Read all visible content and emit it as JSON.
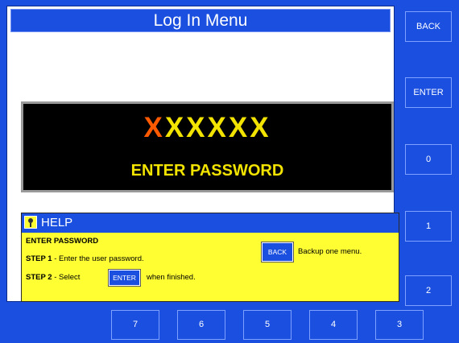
{
  "title": "Log In Menu",
  "password_display": {
    "first_char": "X",
    "rest": "XXXXX",
    "prompt": "ENTER PASSWORD"
  },
  "help": {
    "header": "HELP",
    "heading": "ENTER PASSWORD",
    "step1_label": "STEP 1",
    "step1_sep": " - ",
    "step1_text": "Enter the user password.",
    "step2_label": "STEP 2",
    "step2_sep": " - ",
    "step2_pre": "Select",
    "step2_button": "ENTER",
    "step2_post": "when finished.",
    "back_button": "BACK",
    "back_text": "Backup one menu."
  },
  "side_buttons": [
    "BACK",
    "ENTER",
    "0",
    "1",
    "2"
  ],
  "bottom_buttons": [
    "7",
    "6",
    "5",
    "4",
    "3"
  ],
  "colors": {
    "panel_blue": "#1a4fe0",
    "help_yellow": "#fefe33",
    "mask_accent": "#ff5a00",
    "mask_text": "#f2e300"
  }
}
